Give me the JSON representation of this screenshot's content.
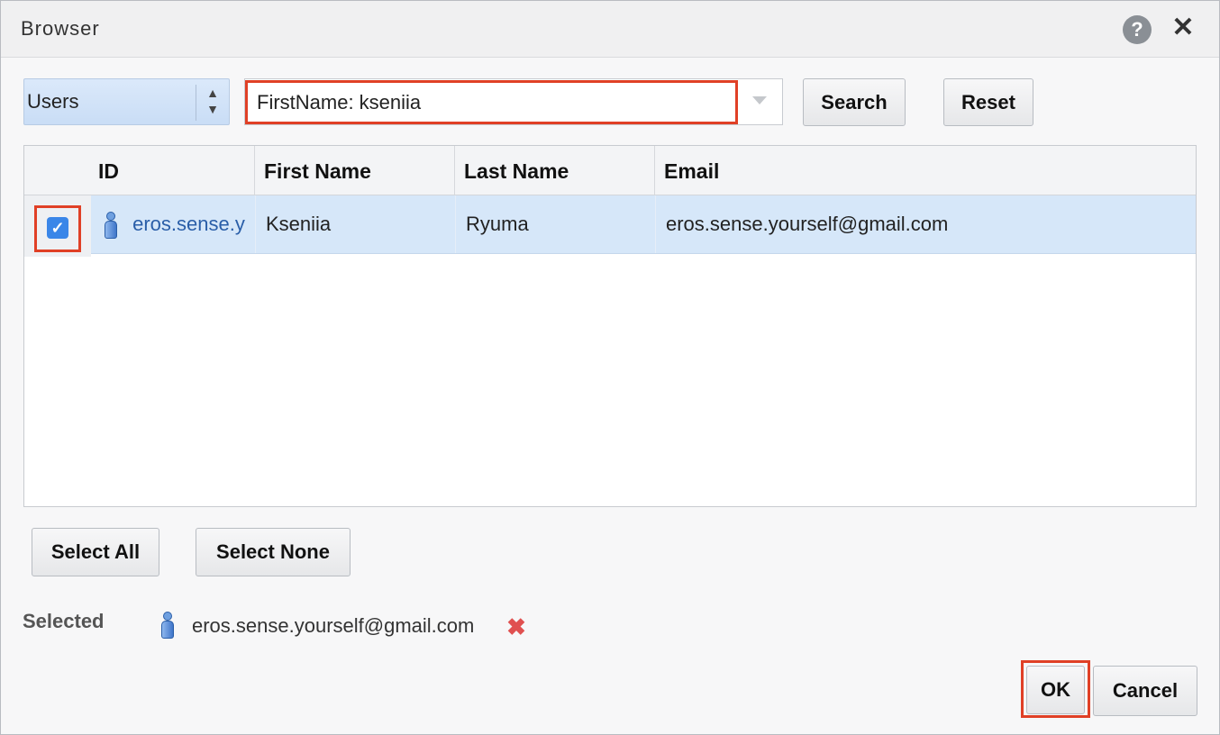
{
  "dialog": {
    "title": "Browser"
  },
  "search": {
    "type_label": "Users",
    "query_value": "FirstName: kseniia",
    "search_label": "Search",
    "reset_label": "Reset"
  },
  "table": {
    "columns": [
      "ID",
      "First Name",
      "Last Name",
      "Email"
    ],
    "rows": [
      {
        "checked": true,
        "id": "eros.sense.y",
        "first_name": "Kseniia",
        "last_name": "Ryuma",
        "email": "eros.sense.yourself@gmail.com"
      }
    ]
  },
  "selection_buttons": {
    "select_all": "Select All",
    "select_none": "Select None"
  },
  "selected": {
    "label": "Selected",
    "value": "eros.sense.yourself@gmail.com"
  },
  "footer": {
    "ok_label": "OK",
    "cancel_label": "Cancel"
  },
  "colors": {
    "highlight": "#e04026",
    "row_selected": "#d6e7f9",
    "link": "#2a5ea8"
  }
}
